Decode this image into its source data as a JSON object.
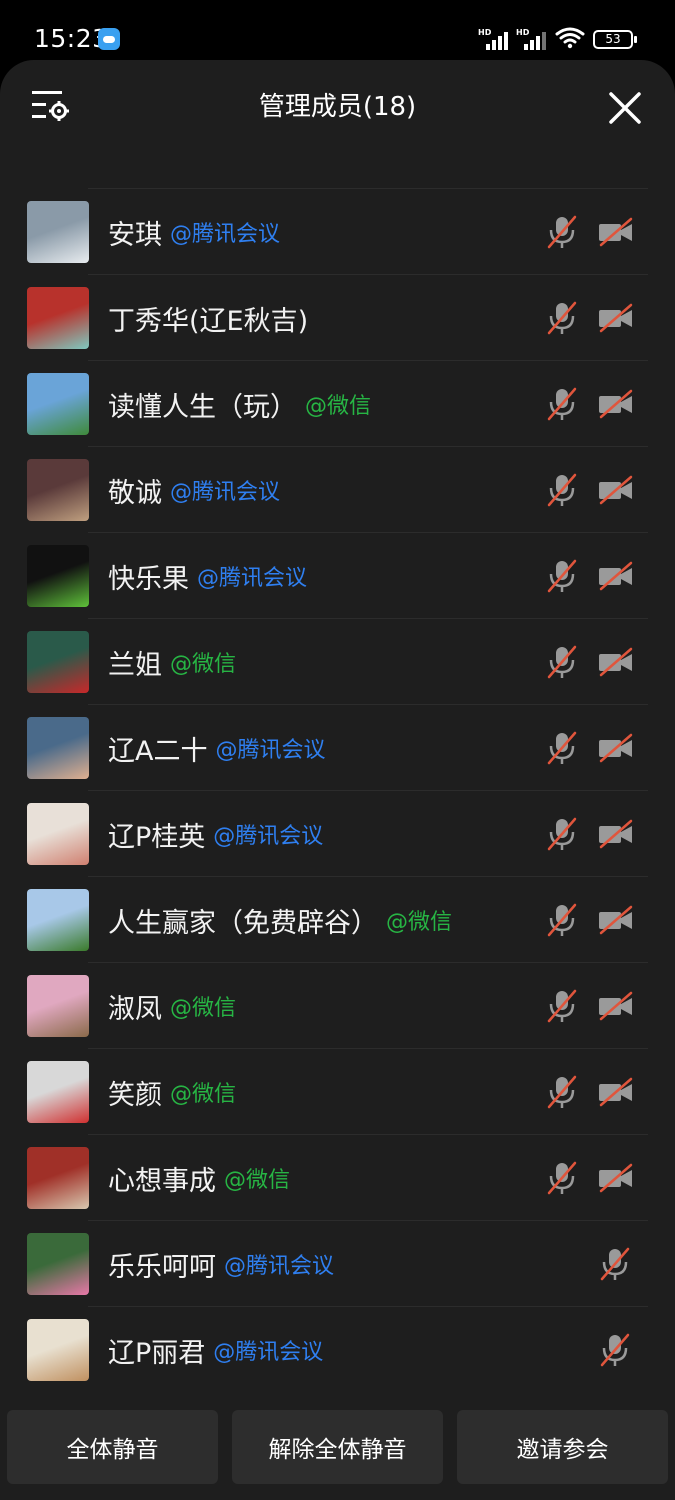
{
  "status_bar": {
    "time": "15:23",
    "signal_1_label": "HD",
    "signal_2_label": "HD",
    "battery": "53",
    "icons": [
      "cloud-icon",
      "signal-icon",
      "wifi-icon",
      "battery-icon"
    ]
  },
  "header": {
    "title": "管理成员(18)",
    "settings_icon": "settings-list-icon",
    "close_icon": "close-icon"
  },
  "colors": {
    "background": "#1e1e1e",
    "tencent": "#2f7ff0",
    "wechat": "#27b544",
    "muted_red": "#e0553c",
    "button": "#2d2d2d"
  },
  "members": [
    {
      "name": "安琪",
      "source": "@腾讯会议",
      "source_type": "tencent",
      "mic": "muted",
      "camera": "off"
    },
    {
      "name": "丁秀华(辽E秋吉)",
      "source": "",
      "source_type": "none",
      "mic": "muted",
      "camera": "off"
    },
    {
      "name": "读懂人生（玩）",
      "source": "@微信",
      "source_type": "wechat",
      "mic": "muted",
      "camera": "off"
    },
    {
      "name": "敬诚",
      "source": "@腾讯会议",
      "source_type": "tencent",
      "mic": "muted",
      "camera": "off"
    },
    {
      "name": "快乐果",
      "source": "@腾讯会议",
      "source_type": "tencent",
      "mic": "muted",
      "camera": "off"
    },
    {
      "name": "兰姐",
      "source": "@微信",
      "source_type": "wechat",
      "mic": "muted",
      "camera": "off"
    },
    {
      "name": "辽A二十",
      "source": "@腾讯会议",
      "source_type": "tencent",
      "mic": "muted",
      "camera": "off"
    },
    {
      "name": "辽P桂英",
      "source": "@腾讯会议",
      "source_type": "tencent",
      "mic": "muted",
      "camera": "off"
    },
    {
      "name": "人生赢家（免费辟谷）",
      "source": "@微信",
      "source_type": "wechat",
      "mic": "muted",
      "camera": "off"
    },
    {
      "name": "淑凤",
      "source": "@微信",
      "source_type": "wechat",
      "mic": "muted",
      "camera": "off"
    },
    {
      "name": "笑颜",
      "source": "@微信",
      "source_type": "wechat",
      "mic": "muted",
      "camera": "off"
    },
    {
      "name": "心想事成",
      "source": "@微信",
      "source_type": "wechat",
      "mic": "muted",
      "camera": "off"
    },
    {
      "name": "乐乐呵呵",
      "source": "@腾讯会议",
      "source_type": "tencent",
      "mic": "muted",
      "camera": "none"
    },
    {
      "name": "辽P丽君",
      "source": "@腾讯会议",
      "source_type": "tencent",
      "mic": "muted",
      "camera": "none"
    }
  ],
  "footer": {
    "mute_all": "全体静音",
    "unmute_all": "解除全体静音",
    "invite": "邀请参会"
  }
}
